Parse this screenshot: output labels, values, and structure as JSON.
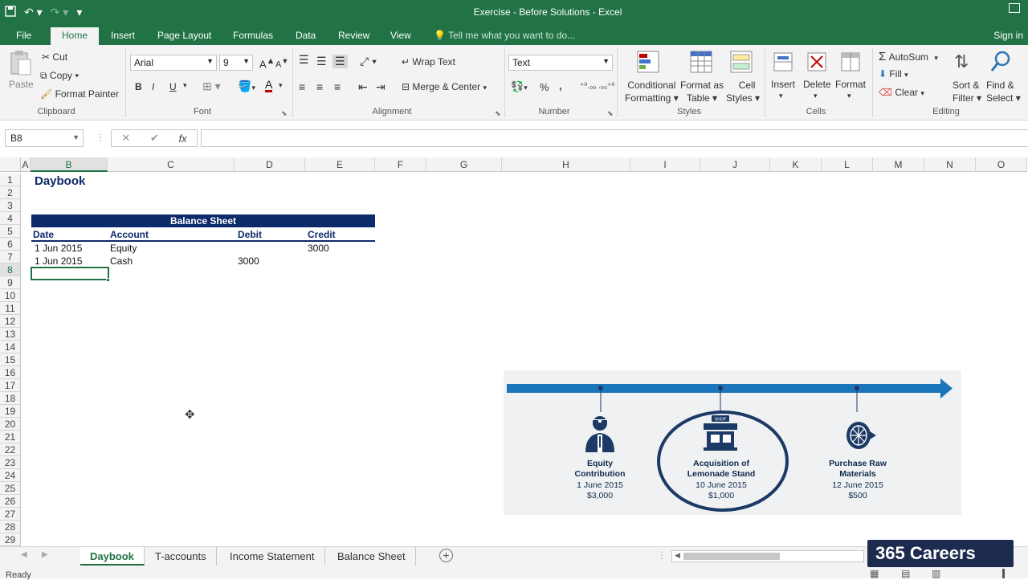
{
  "window": {
    "title": "Exercise - Before Solutions - Excel"
  },
  "menu_tabs": [
    "File",
    "Home",
    "Insert",
    "Page Layout",
    "Formulas",
    "Data",
    "Review",
    "View"
  ],
  "tell_me": "Tell me what you want to do...",
  "sign_in": "Sign in",
  "ribbon": {
    "clipboard": {
      "paste": "Paste",
      "cut": "Cut",
      "copy": "Copy",
      "format_painter": "Format Painter",
      "label": "Clipboard"
    },
    "font": {
      "name": "Arial",
      "size": "9",
      "bold": "B",
      "italic": "I",
      "underline": "U",
      "label": "Font"
    },
    "alignment": {
      "wrap": "Wrap Text",
      "merge": "Merge & Center",
      "label": "Alignment"
    },
    "number": {
      "format": "Text",
      "percent": "%",
      "comma": ",",
      "label": "Number"
    },
    "styles": {
      "conditional_1": "Conditional",
      "conditional_2": "Formatting",
      "format_table_1": "Format as",
      "format_table_2": "Table",
      "cell_styles_1": "Cell",
      "cell_styles_2": "Styles",
      "label": "Styles"
    },
    "cells": {
      "insert": "Insert",
      "delete": "Delete",
      "format": "Format",
      "label": "Cells"
    },
    "editing": {
      "autosum": "AutoSum",
      "fill": "Fill",
      "clear": "Clear",
      "sort_1": "Sort &",
      "sort_2": "Filter",
      "find_1": "Find &",
      "find_2": "Select",
      "label": "Editing"
    }
  },
  "formula_bar": {
    "name_box": "B8",
    "cancel": "✕",
    "enter": "✔",
    "fx": "fx",
    "value": ""
  },
  "columns": [
    "A",
    "B",
    "C",
    "D",
    "E",
    "F",
    "G",
    "H",
    "I",
    "J",
    "K",
    "L",
    "M",
    "N",
    "O"
  ],
  "rows": [
    "1",
    "2",
    "3",
    "4",
    "5",
    "6",
    "7",
    "8",
    "9",
    "10",
    "11",
    "12",
    "13",
    "14",
    "15",
    "16",
    "17",
    "18",
    "19",
    "20",
    "21",
    "22",
    "23",
    "24",
    "25",
    "26",
    "27",
    "28",
    "29"
  ],
  "sheet": {
    "title": "Daybook",
    "table_header": "Balance Sheet",
    "col_headers": [
      "Date",
      "Account",
      "Debit",
      "Credit"
    ],
    "entries": [
      {
        "date": "1 Jun 2015",
        "account": "Equity",
        "debit": "",
        "credit": "3000"
      },
      {
        "date": "1 Jun 2015",
        "account": "Cash",
        "debit": "3000",
        "credit": ""
      }
    ]
  },
  "timeline": {
    "events": [
      {
        "line1": "Equity",
        "line2": "Contribution",
        "date": "1 June 2015",
        "amount": "$3,000"
      },
      {
        "line1": "Acquisition of",
        "line2": "Lemonade Stand",
        "date": "10 June 2015",
        "amount": "$1,000"
      },
      {
        "line1": "Purchase Raw",
        "line2": "Materials",
        "date": "12 June 2015",
        "amount": "$500"
      }
    ],
    "shop_sign": "SHOP"
  },
  "sheet_tabs": [
    "Daybook",
    "T-accounts",
    "Income Statement",
    "Balance Sheet"
  ],
  "status": {
    "ready": "Ready"
  },
  "brand": {
    "text": "365 Careers"
  },
  "colors": {
    "excel_green": "#217346",
    "table_navy": "#0d2a6b",
    "timeline_blue": "#1a75bb",
    "circle_navy": "#1d3a66"
  }
}
